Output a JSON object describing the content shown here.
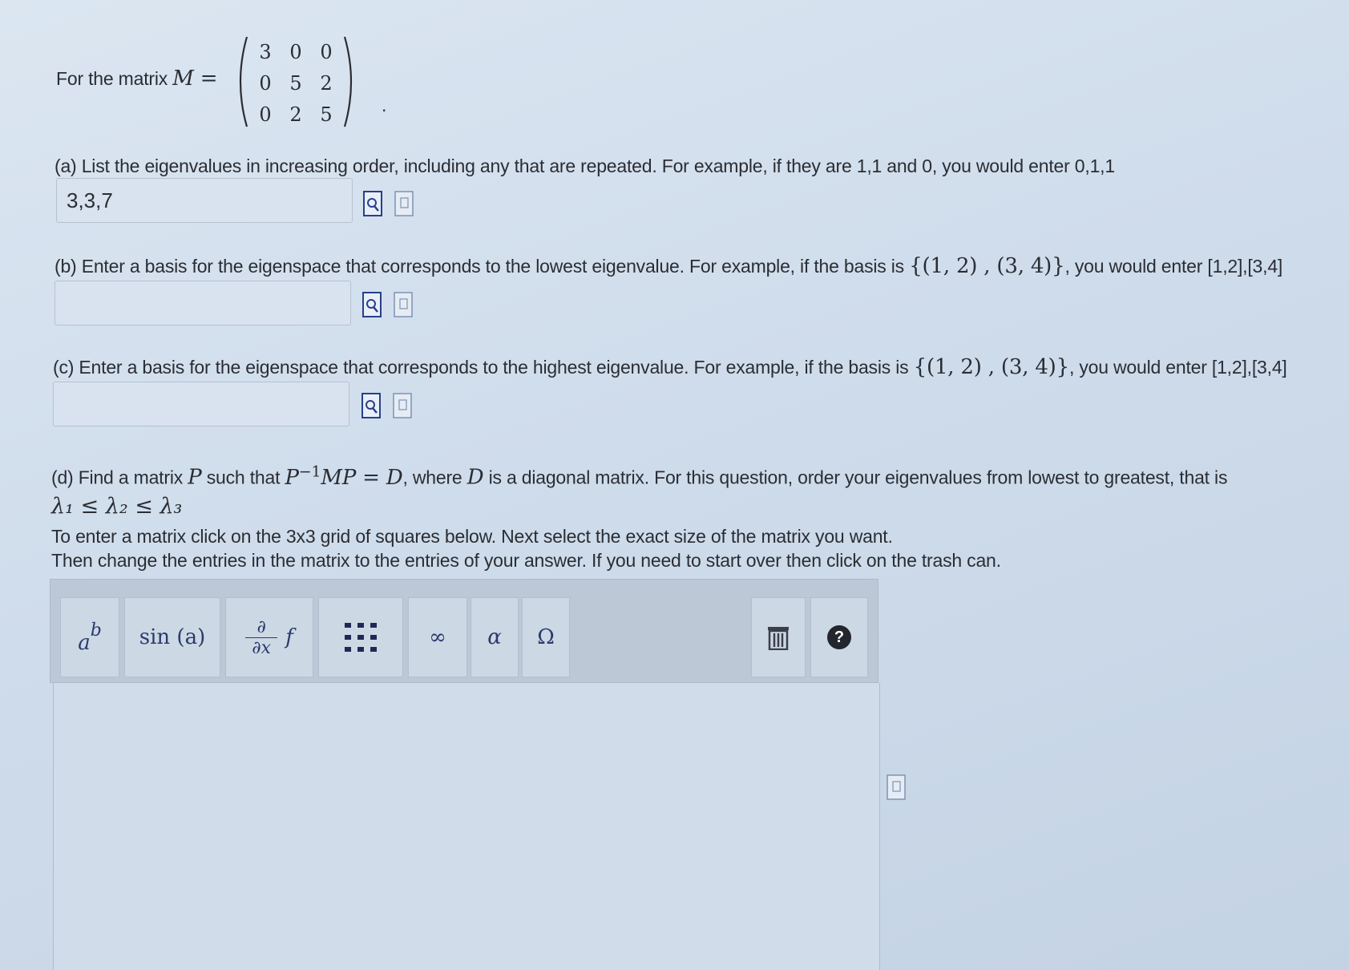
{
  "intro": {
    "prefix": "For the matrix",
    "symbol": "M =",
    "matrix": [
      [
        "3",
        "0",
        "0"
      ],
      [
        "0",
        "5",
        "2"
      ],
      [
        "0",
        "2",
        "5"
      ]
    ],
    "trailing": "."
  },
  "part_a": {
    "text": "(a) List the eigenvalues in increasing order, including any that are repeated. For example, if they are 1,1 and 0, you would enter 0,1,1",
    "answer_value": "3,3,7"
  },
  "part_b": {
    "text_before": "(b) Enter a basis for the eigenspace that corresponds to the lowest eigenvalue. For example, if the basis is",
    "example_set": "{(1, 2) , (3, 4)}",
    "text_after": ", you would enter [1,2],[3,4]",
    "answer_value": ""
  },
  "part_c": {
    "text_before": "(c) Enter a basis for the eigenspace that corresponds to the highest eigenvalue. For example, if the basis is",
    "example_set": "{(1, 2) , (3, 4)}",
    "text_after": ", you would enter [1,2],[3,4]",
    "answer_value": ""
  },
  "part_d": {
    "label": "(d) Find a matrix",
    "P": "P",
    "such_that": "such that",
    "equation": "P",
    "sup": "−1",
    "equation_rest": "MP = D",
    "where": ", where",
    "D": "D",
    "rest": "is a diagonal matrix. For this question, order your eigenvalues from lowest to greatest, that is",
    "ordering": "λ₁ ≤ λ₂ ≤ λ₃",
    "instruction_1": "To enter a matrix click on the 3x3 grid of squares below. Next select the exact size of the matrix you want.",
    "instruction_2": "Then change the entries in the matrix to the entries of your answer. If you need to start over then click on the trash can."
  },
  "toolbar": {
    "power": {
      "base": "a",
      "exp": "b"
    },
    "trig": "sin (a)",
    "deriv_top": "∂",
    "deriv_bottom": "∂x",
    "deriv_f": "f",
    "infinity": "∞",
    "alpha": "α",
    "omega": "Ω",
    "help": "?"
  }
}
